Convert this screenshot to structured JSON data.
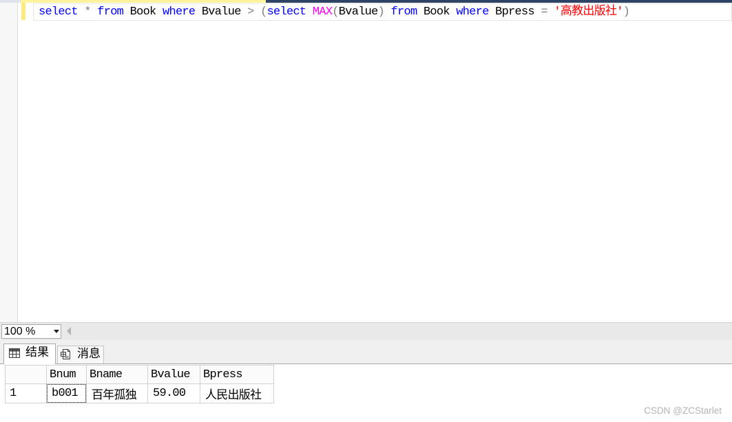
{
  "document_tab_bar": {
    "active_tab_color": "#fff29d",
    "inactive_area_color": "#2f4366"
  },
  "editor": {
    "change_marker_color": "#fde97c",
    "lines": [
      {
        "tokens": [
          {
            "text": "select",
            "color": "#0000ff"
          },
          {
            "text": " * ",
            "color": "#808080"
          },
          {
            "text": "from",
            "color": "#0000ff"
          },
          {
            "text": " Book ",
            "color": "#000000"
          },
          {
            "text": "where",
            "color": "#0000ff"
          },
          {
            "text": " Bvalue ",
            "color": "#000000"
          },
          {
            "text": "> (",
            "color": "#808080"
          },
          {
            "text": "select ",
            "color": "#0000ff"
          },
          {
            "text": "MAX",
            "color": "#ff00ff"
          },
          {
            "text": "(",
            "color": "#808080"
          },
          {
            "text": "Bvalue",
            "color": "#000000"
          },
          {
            "text": ") ",
            "color": "#808080"
          },
          {
            "text": "from",
            "color": "#0000ff"
          },
          {
            "text": " Book ",
            "color": "#000000"
          },
          {
            "text": "where",
            "color": "#0000ff"
          },
          {
            "text": " Bpress ",
            "color": "#000000"
          },
          {
            "text": "= ",
            "color": "#808080"
          },
          {
            "text": "'高教出版社'",
            "color": "#ff0000"
          },
          {
            "text": ")",
            "color": "#808080"
          }
        ]
      }
    ]
  },
  "zoom": {
    "value": "100 %"
  },
  "results": {
    "tabs": [
      {
        "label": "结果",
        "icon": "grid-icon",
        "selected": true
      },
      {
        "label": "消息",
        "icon": "message-icon",
        "selected": false
      }
    ],
    "grid": {
      "columns": [
        "Bnum",
        "Bname",
        "Bvalue",
        "Bpress"
      ],
      "rows": [
        {
          "row_number": "1",
          "cells": [
            "b001",
            "百年孤独",
            "59.00",
            "人民出版社"
          ]
        }
      ],
      "focused_cell": {
        "row_index": 0,
        "column_index": 0
      }
    }
  },
  "watermark": "CSDN @ZCStarlet"
}
